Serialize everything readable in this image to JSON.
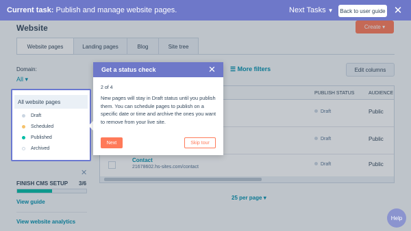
{
  "taskbar": {
    "task_prefix": "Current task:",
    "task_text": "Publish and manage website pages.",
    "next_tasks": "Next Tasks",
    "back_to_guide": "Back to user guide"
  },
  "page": {
    "title": "Website",
    "create_label": "Create",
    "tabs": [
      "Website pages",
      "Landing pages",
      "Blog",
      "Site tree"
    ],
    "domain_label": "Domain:",
    "domain_value": "All",
    "more_filters": "More filters",
    "edit_columns": "Edit columns"
  },
  "table": {
    "headers": [
      "PUBLISH STATUS",
      "AUDIENCE"
    ],
    "rows": [
      {
        "name": "",
        "url": "",
        "status": "Draft",
        "audience": "Public"
      },
      {
        "name": "",
        "url": "",
        "status": "Draft",
        "audience": "Public"
      },
      {
        "name": "Contact",
        "url": "21678602.hs-sites.com/contact",
        "status": "Draft",
        "audience": "Public"
      }
    ],
    "per_page": "25 per page"
  },
  "filters": {
    "all": "All website pages",
    "items": [
      {
        "label": "Draft",
        "color": "#cbd6e2"
      },
      {
        "label": "Scheduled",
        "color": "#f5c26b"
      },
      {
        "label": "Published",
        "color": "#00bda5"
      },
      {
        "label": "Archived",
        "color": "#ffffff"
      }
    ]
  },
  "sidebar": {
    "cms_setup": "FINISH CMS SETUP",
    "cms_count": "3/6",
    "progress": 0.5,
    "view_guide": "View guide",
    "view_analytics": "View website analytics"
  },
  "popover": {
    "title": "Get a status check",
    "step": "2 of 4",
    "body": "New pages will stay in Draft status until you publish them. You can schedule pages to publish on a specific date or time and archive the ones you want to remove from your live site.",
    "next": "Next",
    "skip": "Skip tour"
  },
  "help": "Help",
  "colors": {
    "taskbar": "#6e78c9",
    "accent": "#ff7a59",
    "link": "#0091ae"
  }
}
